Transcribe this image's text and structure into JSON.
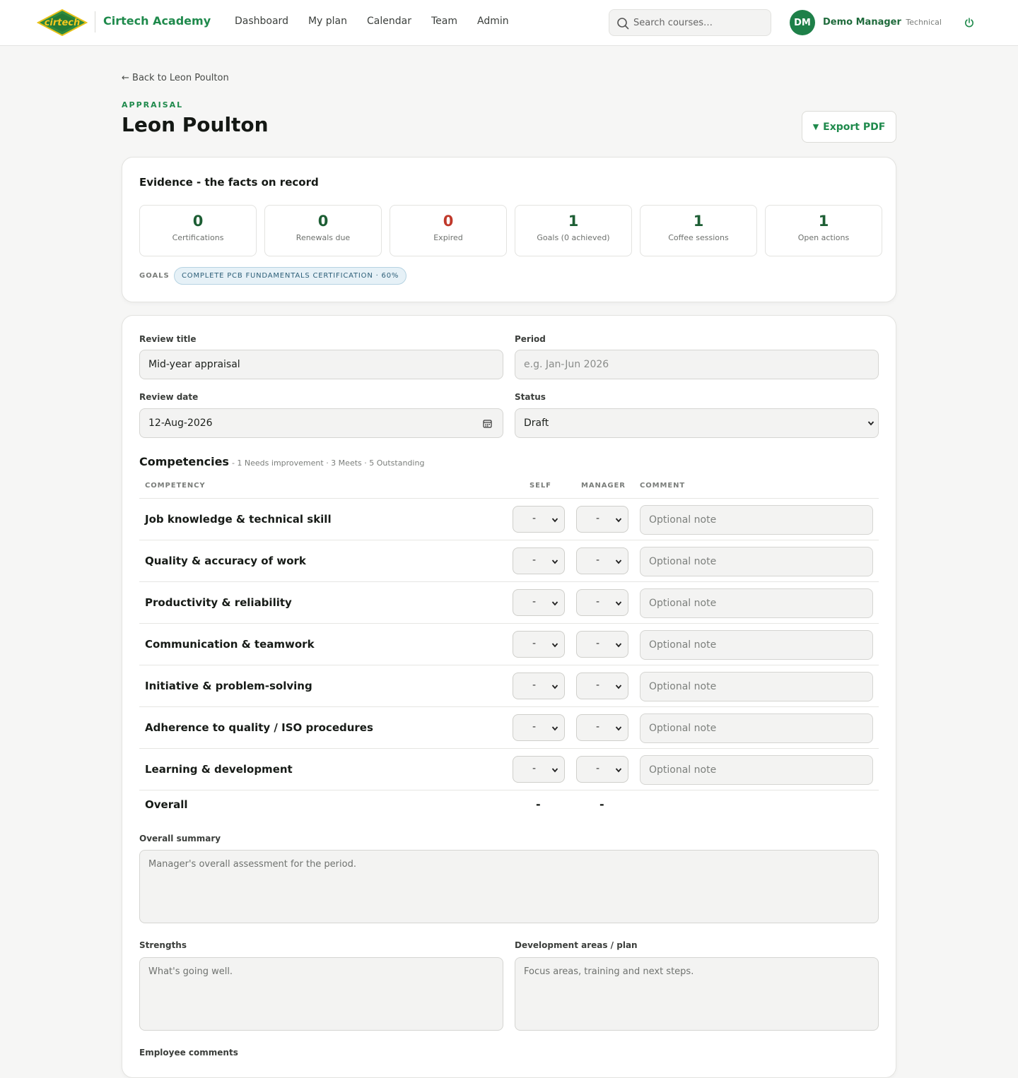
{
  "header": {
    "logo_text": "cirtech",
    "brand": "Cirtech Academy",
    "nav": [
      "Dashboard",
      "My plan",
      "Calendar",
      "Team",
      "Admin"
    ],
    "search_placeholder": "Search courses…",
    "avatar_initials": "DM",
    "user_name": "Demo Manager",
    "user_role": "Technical"
  },
  "page": {
    "back_link": "← Back to Leon Poulton",
    "eyebrow": "APPRAISAL",
    "title": "Leon Poulton",
    "export_label": "Export PDF"
  },
  "evidence": {
    "title": "Evidence - the facts on record",
    "stats": [
      {
        "value": "0",
        "label": "Certifications"
      },
      {
        "value": "0",
        "label": "Renewals due"
      },
      {
        "value": "0",
        "label": "Expired"
      },
      {
        "value": "1",
        "label": "Goals (0 achieved)"
      },
      {
        "value": "1",
        "label": "Coffee sessions"
      },
      {
        "value": "1",
        "label": "Open actions"
      }
    ],
    "goals_label": "GOALS",
    "goal_chip": "COMPLETE PCB FUNDAMENTALS CERTIFICATION · 60%"
  },
  "form": {
    "review_title_label": "Review title",
    "review_title_value": "Mid-year appraisal",
    "period_label": "Period",
    "period_placeholder": "e.g. Jan-Jun 2026",
    "review_date_label": "Review date",
    "review_date_value": "12-Aug-2026",
    "status_label": "Status",
    "status_value": "Draft",
    "competencies_title": "Competencies",
    "competencies_scale": "- 1 Needs improvement · 3 Meets · 5 Outstanding",
    "headers": {
      "competency": "COMPETENCY",
      "self": "SELF",
      "manager": "MANAGER",
      "comment": "COMMENT"
    },
    "rows": [
      {
        "name": "Job knowledge & technical skill",
        "self": "-",
        "manager": "-",
        "note_placeholder": "Optional note"
      },
      {
        "name": "Quality & accuracy of work",
        "self": "-",
        "manager": "-",
        "note_placeholder": "Optional note"
      },
      {
        "name": "Productivity & reliability",
        "self": "-",
        "manager": "-",
        "note_placeholder": "Optional note"
      },
      {
        "name": "Communication & teamwork",
        "self": "-",
        "manager": "-",
        "note_placeholder": "Optional note"
      },
      {
        "name": "Initiative & problem-solving",
        "self": "-",
        "manager": "-",
        "note_placeholder": "Optional note"
      },
      {
        "name": "Adherence to quality / ISO procedures",
        "self": "-",
        "manager": "-",
        "note_placeholder": "Optional note"
      },
      {
        "name": "Learning & development",
        "self": "-",
        "manager": "-",
        "note_placeholder": "Optional note"
      }
    ],
    "overall_label": "Overall",
    "overall_self": "-",
    "overall_manager": "-",
    "summary_label": "Overall summary",
    "summary_placeholder": "Manager's overall assessment for the period.",
    "strengths_label": "Strengths",
    "strengths_placeholder": "What's going well.",
    "development_label": "Development areas / plan",
    "development_placeholder": "Focus areas, training and next steps.",
    "employee_comments_label": "Employee comments"
  },
  "colors": {
    "brand": "#1f8a4c",
    "expired": "#c0392b",
    "stat": "#1d5e34"
  }
}
